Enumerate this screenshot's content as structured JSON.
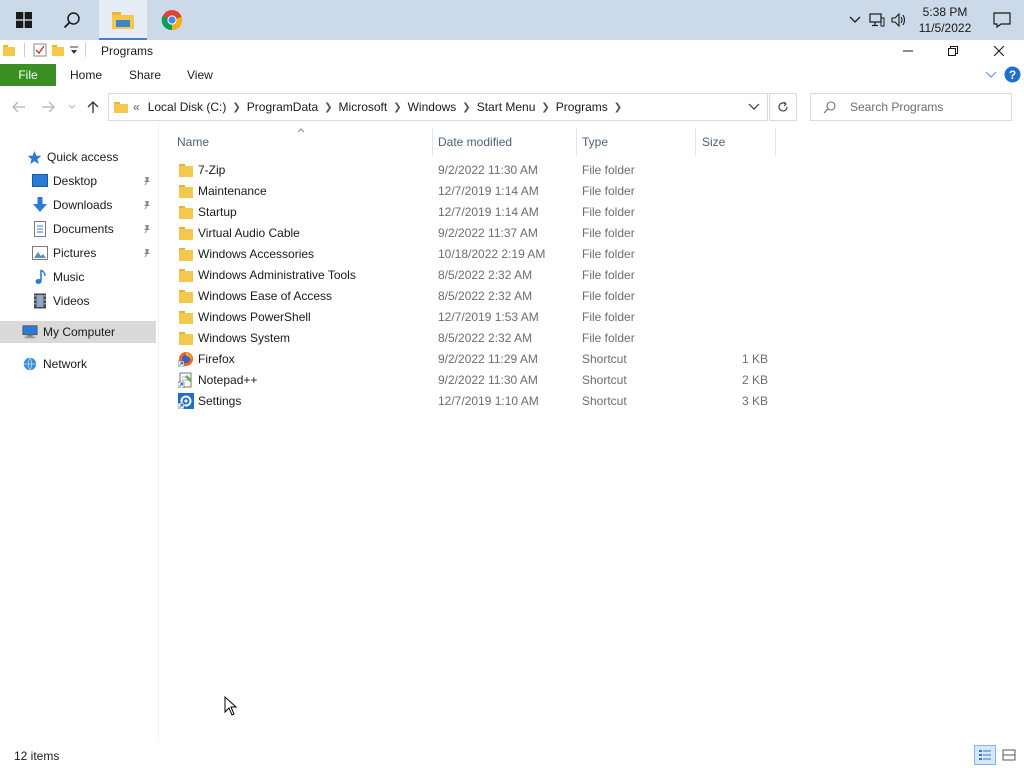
{
  "taskbar": {
    "clock_time": "5:38 PM",
    "clock_date": "11/5/2022"
  },
  "window": {
    "title": "Programs"
  },
  "ribbon": {
    "tabs": [
      "File",
      "Home",
      "Share",
      "View"
    ]
  },
  "address": {
    "overflow": "«",
    "crumbs": [
      "Local Disk (C:)",
      "ProgramData",
      "Microsoft",
      "Windows",
      "Start Menu",
      "Programs"
    ]
  },
  "search": {
    "placeholder": "Search Programs"
  },
  "navpane": {
    "quick_access": "Quick access",
    "items": [
      "Desktop",
      "Downloads",
      "Documents",
      "Pictures",
      "Music",
      "Videos"
    ],
    "my_computer": "My Computer",
    "network": "Network"
  },
  "columns": {
    "name": "Name",
    "date": "Date modified",
    "type": "Type",
    "size": "Size"
  },
  "files": [
    {
      "name": "7-Zip",
      "date": "9/2/2022 11:30 AM",
      "type": "File folder",
      "size": "",
      "icon": "folder-icon"
    },
    {
      "name": "Maintenance",
      "date": "12/7/2019 1:14 AM",
      "type": "File folder",
      "size": "",
      "icon": "folder-icon"
    },
    {
      "name": "Startup",
      "date": "12/7/2019 1:14 AM",
      "type": "File folder",
      "size": "",
      "icon": "folder-icon"
    },
    {
      "name": "Virtual Audio Cable",
      "date": "9/2/2022 11:37 AM",
      "type": "File folder",
      "size": "",
      "icon": "folder-icon"
    },
    {
      "name": "Windows Accessories",
      "date": "10/18/2022 2:19 AM",
      "type": "File folder",
      "size": "",
      "icon": "folder-icon"
    },
    {
      "name": "Windows Administrative Tools",
      "date": "8/5/2022 2:32 AM",
      "type": "File folder",
      "size": "",
      "icon": "folder-icon"
    },
    {
      "name": "Windows Ease of Access",
      "date": "8/5/2022 2:32 AM",
      "type": "File folder",
      "size": "",
      "icon": "folder-icon"
    },
    {
      "name": "Windows PowerShell",
      "date": "12/7/2019 1:53 AM",
      "type": "File folder",
      "size": "",
      "icon": "folder-icon"
    },
    {
      "name": "Windows System",
      "date": "8/5/2022 2:32 AM",
      "type": "File folder",
      "size": "",
      "icon": "folder-icon"
    },
    {
      "name": "Firefox",
      "date": "9/2/2022 11:29 AM",
      "type": "Shortcut",
      "size": "1 KB",
      "icon": "firefox-icon"
    },
    {
      "name": "Notepad++",
      "date": "9/2/2022 11:30 AM",
      "type": "Shortcut",
      "size": "2 KB",
      "icon": "notepad-icon"
    },
    {
      "name": "Settings",
      "date": "12/7/2019 1:10 AM",
      "type": "Shortcut",
      "size": "3 KB",
      "icon": "settings-icon"
    }
  ],
  "status": {
    "item_count": "12 items"
  },
  "colors": {
    "taskbar_bg": "#ccd9e8",
    "file_tab": "#3a8f22",
    "folder": "#f4c84c",
    "accent": "#1e6fd0"
  }
}
